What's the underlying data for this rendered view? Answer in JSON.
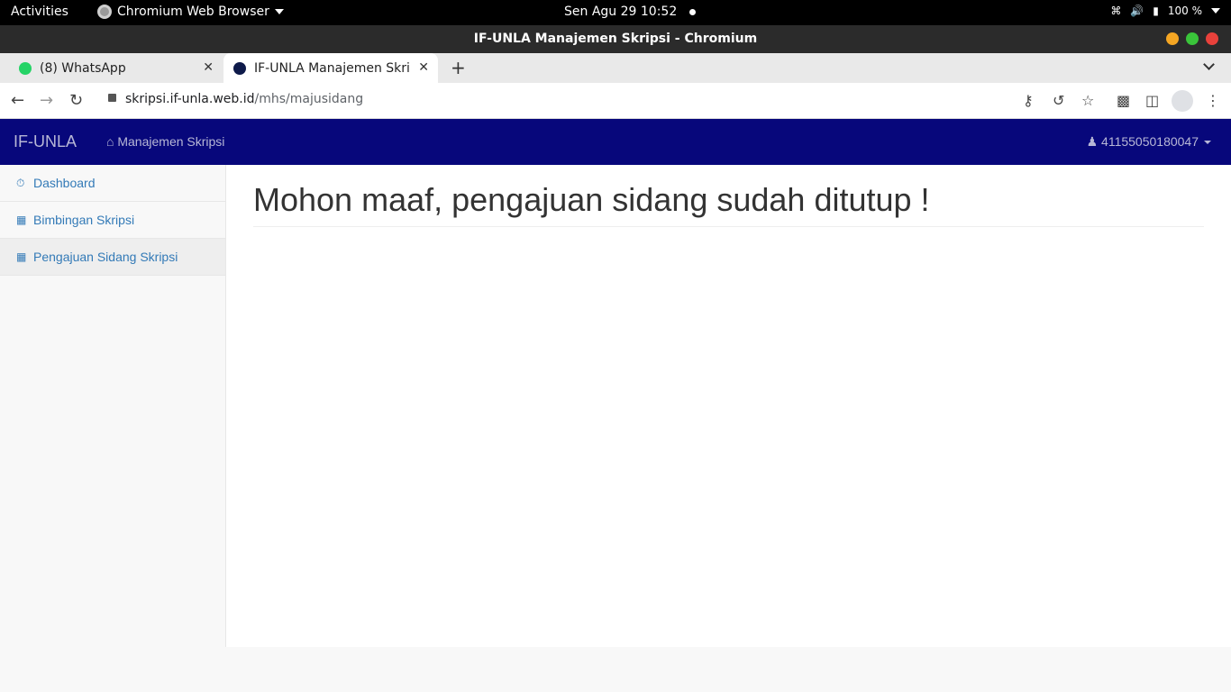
{
  "os_bar": {
    "activities": "Activities",
    "app_name": "Chromium Web Browser",
    "clock": "Sen Agu 29  10:52",
    "battery": "100 %"
  },
  "window": {
    "title": "IF-UNLA Manajemen Skripsi - Chromium"
  },
  "tabs": [
    {
      "title": "(8) WhatsApp",
      "active": false
    },
    {
      "title": "IF-UNLA Manajemen Skrip",
      "active": true
    }
  ],
  "address_bar": {
    "host": "skripsi.if-unla.web.id",
    "path": "/mhs/majusidang"
  },
  "site": {
    "brand": "IF-UNLA",
    "nav_link": "Manajemen Skripsi",
    "user": "41155050180047",
    "sidebar": [
      {
        "label": "Dashboard",
        "icon": "dashboard-icon"
      },
      {
        "label": "Bimbingan Skripsi",
        "icon": "table-icon"
      },
      {
        "label": "Pengajuan Sidang Skripsi",
        "icon": "table-icon"
      }
    ],
    "heading": "Mohon maaf, pengajuan sidang sudah ditutup !"
  },
  "colors": {
    "navbar": "#07077b",
    "link": "#337ab7"
  }
}
